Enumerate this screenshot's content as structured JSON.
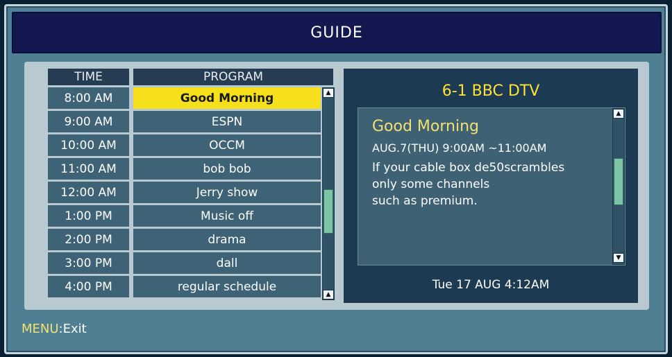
{
  "window": {
    "title": "GUIDE"
  },
  "table": {
    "time_header": "TIME",
    "program_header": "PROGRAM",
    "rows": [
      {
        "time": "8:00 AM",
        "program": "Good Morning"
      },
      {
        "time": "9:00 AM",
        "program": "ESPN"
      },
      {
        "time": "10:00 AM",
        "program": "OCCM"
      },
      {
        "time": "11:00 AM",
        "program": "bob bob"
      },
      {
        "time": "12:00 AM",
        "program": "Jerry show"
      },
      {
        "time": "1:00 PM",
        "program": "Music off"
      },
      {
        "time": "2:00 PM",
        "program": "drama"
      },
      {
        "time": "3:00 PM",
        "program": "dall"
      },
      {
        "time": "4:00 PM",
        "program": "regular  schedule"
      }
    ],
    "selected_index": 0
  },
  "info": {
    "channel": "6-1 BBC DTV",
    "program_title": "Good Morning",
    "airing": "AUG.7(THU) 9:00AM ~11:00AM",
    "description": "If your cable box de50scrambles\nonly some channels\nsuch as premium.",
    "clock": "Tue 17 AUG 4:12AM"
  },
  "footer": {
    "key": "MENU",
    "action": ":Exit"
  },
  "icons": {
    "scroll_up": "arrow-up-icon",
    "scroll_down": "arrow-down-icon"
  },
  "colors": {
    "highlight": "#f6e01c",
    "accent_text": "#ffe13a",
    "title_bar": "#141850"
  }
}
